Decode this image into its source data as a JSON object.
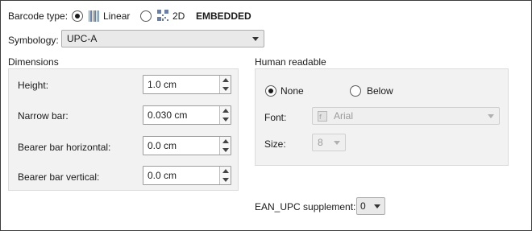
{
  "barcode_type": {
    "label": "Barcode type:",
    "linear_label": "Linear",
    "twod_label": "2D",
    "status": "EMBEDDED"
  },
  "symbology": {
    "label": "Symbology:",
    "value": "UPC-A"
  },
  "dimensions": {
    "title": "Dimensions",
    "fields": [
      {
        "label": "Height:",
        "value": "1.0 cm"
      },
      {
        "label": "Narrow bar:",
        "value": "0.030 cm"
      },
      {
        "label": "Bearer bar horizontal:",
        "value": "0.0 cm"
      },
      {
        "label": "Bearer bar vertical:",
        "value": "0.0 cm"
      }
    ]
  },
  "human_readable": {
    "title": "Human readable",
    "none_label": "None",
    "below_label": "Below",
    "font_label": "Font:",
    "font_value": "Arial",
    "size_label": "Size:",
    "size_value": "8"
  },
  "ean_upc": {
    "label": "EAN_UPC supplement:",
    "value": "0"
  },
  "icons": {
    "linear": "linear-barcode-icon",
    "twod": "qr-code-icon",
    "font": "font-icon"
  }
}
